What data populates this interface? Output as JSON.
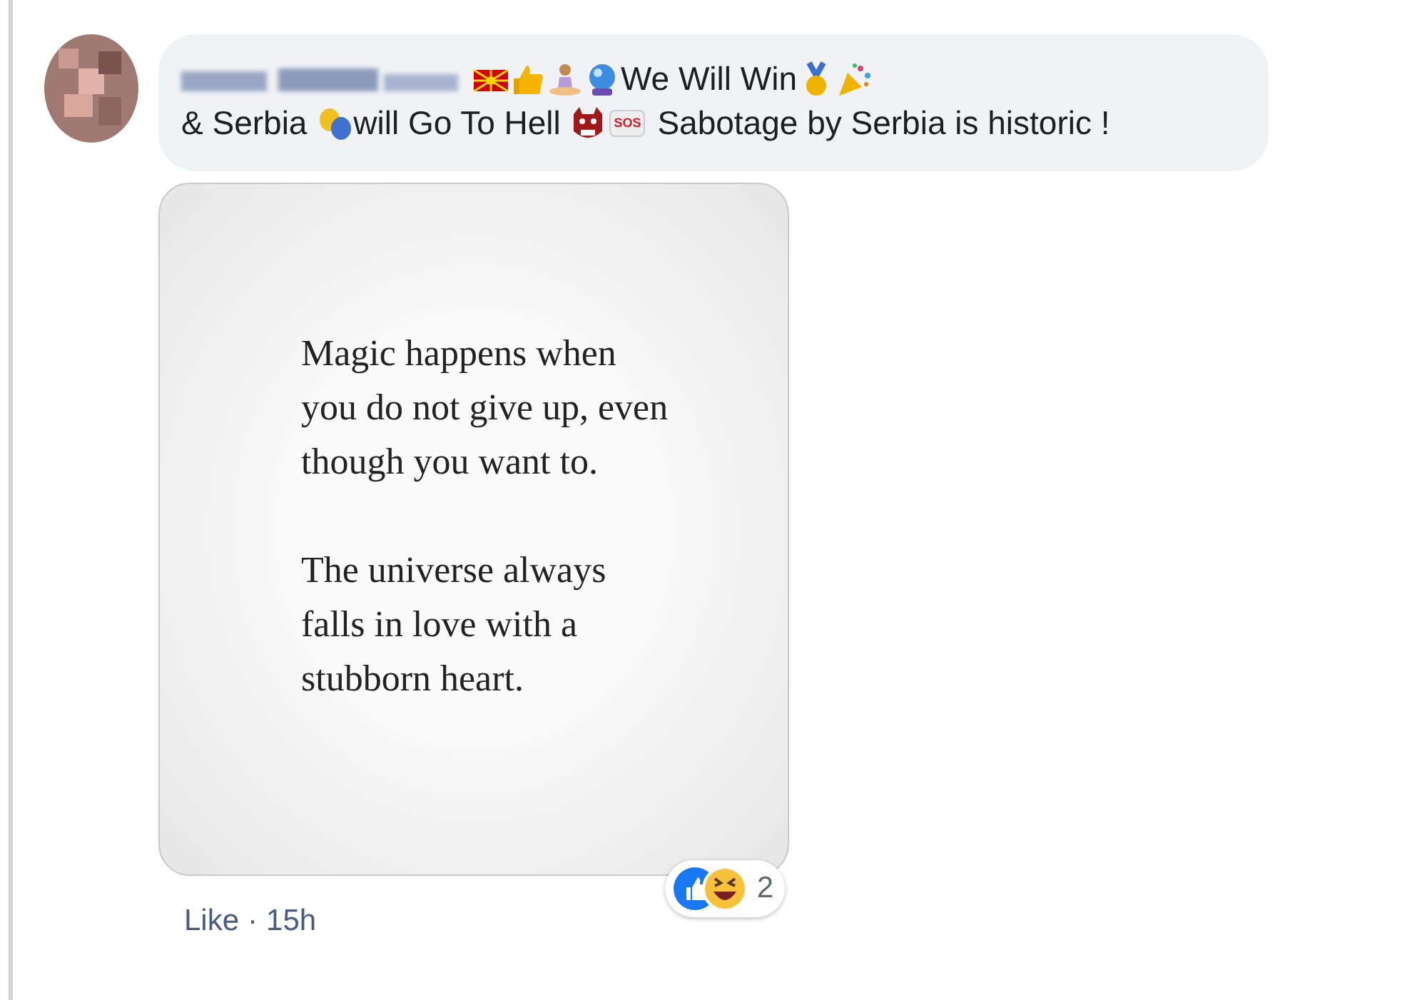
{
  "comment": {
    "lines": [
      [
        {
          "kind": "blurname"
        },
        {
          "kind": "flag"
        },
        {
          "kind": "thumb"
        },
        {
          "kind": "yoga"
        },
        {
          "kind": "ball"
        },
        {
          "kind": "text",
          "text": "We Will Win"
        },
        {
          "kind": "medal"
        },
        {
          "kind": "party"
        }
      ],
      [
        {
          "kind": "text",
          "text": "& Serbia "
        },
        {
          "kind": "masks"
        },
        {
          "kind": "text",
          "text": "will Go To Hell "
        },
        {
          "kind": "ogre"
        },
        {
          "kind": "sos",
          "text": "SOS"
        },
        {
          "kind": "text",
          "text": " Sabotage by Serbia is historic !"
        }
      ]
    ],
    "attachment": {
      "paragraphs": [
        "Magic happens when you do not give up, even though you want to.",
        "The universe always falls in love with a stubborn heart."
      ]
    },
    "reactions": {
      "count": "2"
    },
    "actions": {
      "like": "Like",
      "separator": "·",
      "time": "15h"
    }
  }
}
